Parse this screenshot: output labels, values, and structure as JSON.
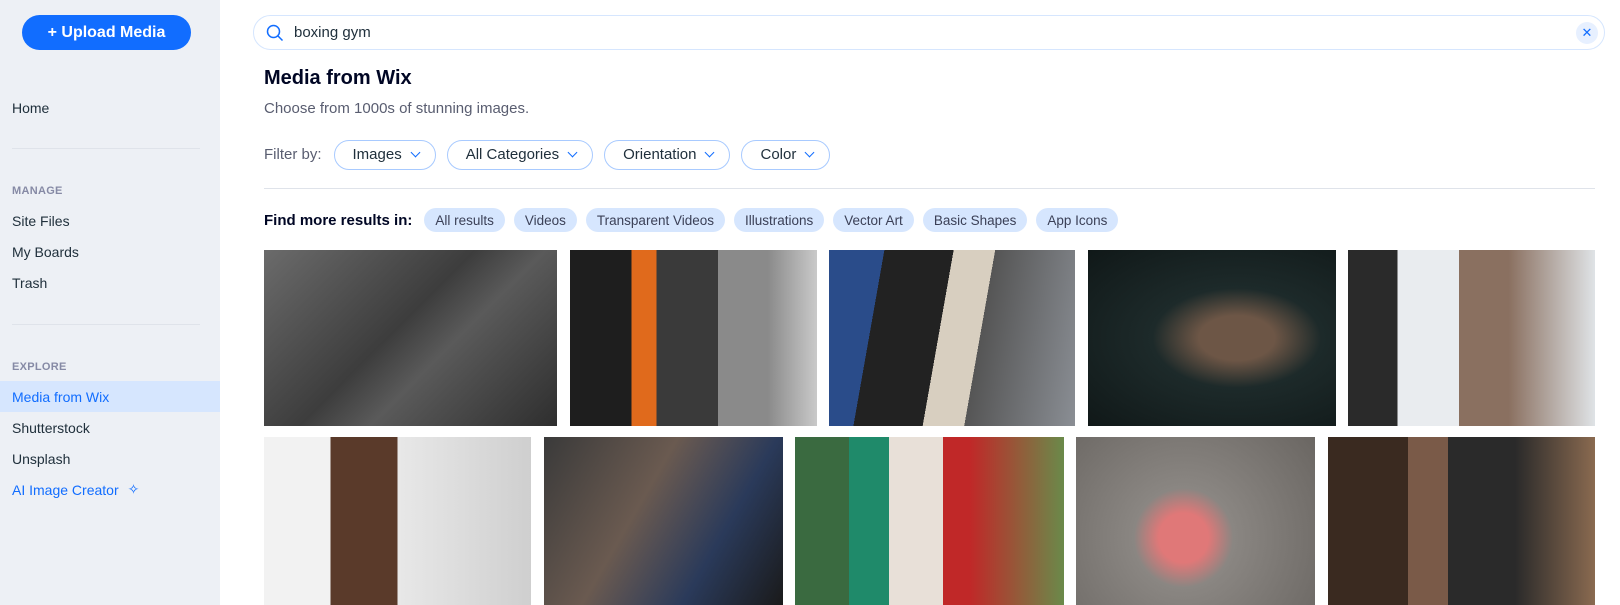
{
  "sidebar": {
    "upload_label": "+ Upload Media",
    "home": "Home",
    "manage_header": "MANAGE",
    "manage": [
      "Site Files",
      "My Boards",
      "Trash"
    ],
    "explore_header": "EXPLORE",
    "explore": [
      "Media from Wix",
      "Shutterstock",
      "Unsplash",
      "AI Image Creator"
    ],
    "active": "Media from Wix"
  },
  "search": {
    "value": "boxing gym",
    "icon": "search-icon",
    "clear_icon": "close-icon"
  },
  "main": {
    "title": "Media from Wix",
    "subtitle": "Choose from 1000s of stunning images.",
    "filter_label": "Filter by:",
    "filters": [
      "Images",
      "All Categories",
      "Orientation",
      "Color"
    ],
    "more_label": "Find more results in:",
    "chips": [
      "All results",
      "Videos",
      "Transparent Videos",
      "Illustrations",
      "Vector Art",
      "Basic Shapes",
      "App Icons"
    ]
  },
  "colors": {
    "accent": "#116dff",
    "sidebar_bg": "#edf0f5",
    "active_bg": "#d6e6fe",
    "chip_bg": "#d6e6fe"
  }
}
